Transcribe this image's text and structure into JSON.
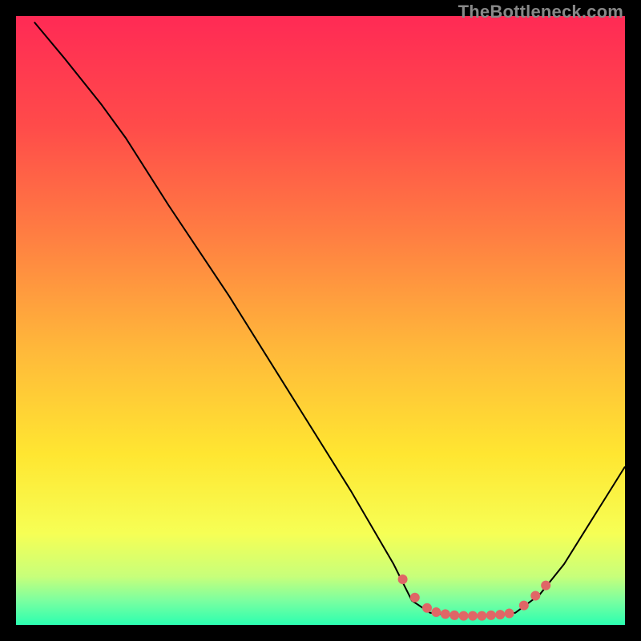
{
  "watermark": "TheBottleneck.com",
  "chart_data": {
    "type": "line",
    "title": "",
    "xlabel": "",
    "ylabel": "",
    "xlim": [
      0,
      100
    ],
    "ylim": [
      0,
      100
    ],
    "grid": false,
    "gradient_stops": [
      {
        "offset": 0,
        "color": "#ff2a55"
      },
      {
        "offset": 18,
        "color": "#ff4b4a"
      },
      {
        "offset": 36,
        "color": "#ff7e42"
      },
      {
        "offset": 55,
        "color": "#ffb93a"
      },
      {
        "offset": 72,
        "color": "#ffe631"
      },
      {
        "offset": 85,
        "color": "#f6ff55"
      },
      {
        "offset": 92,
        "color": "#c8ff7a"
      },
      {
        "offset": 96,
        "color": "#7bffa0"
      },
      {
        "offset": 100,
        "color": "#2bffb0"
      }
    ],
    "series": [
      {
        "name": "curve",
        "color": "#000000",
        "stroke_width": 2,
        "points": [
          {
            "x": 3,
            "y": 99
          },
          {
            "x": 8,
            "y": 93
          },
          {
            "x": 14,
            "y": 85.5
          },
          {
            "x": 18,
            "y": 80
          },
          {
            "x": 25,
            "y": 69
          },
          {
            "x": 35,
            "y": 54
          },
          {
            "x": 45,
            "y": 38
          },
          {
            "x": 55,
            "y": 22
          },
          {
            "x": 62,
            "y": 10
          },
          {
            "x": 65,
            "y": 4
          },
          {
            "x": 68,
            "y": 2
          },
          {
            "x": 72,
            "y": 1.5
          },
          {
            "x": 78,
            "y": 1.5
          },
          {
            "x": 82,
            "y": 2
          },
          {
            "x": 86,
            "y": 5
          },
          {
            "x": 90,
            "y": 10
          },
          {
            "x": 95,
            "y": 18
          },
          {
            "x": 100,
            "y": 26
          }
        ]
      },
      {
        "name": "highlight-dots",
        "color": "#e06666",
        "marker_radius": 6,
        "points": [
          {
            "x": 63.5,
            "y": 7.5
          },
          {
            "x": 65.5,
            "y": 4.5
          },
          {
            "x": 67.5,
            "y": 2.8
          },
          {
            "x": 69,
            "y": 2.1
          },
          {
            "x": 70.5,
            "y": 1.8
          },
          {
            "x": 72,
            "y": 1.6
          },
          {
            "x": 73.5,
            "y": 1.5
          },
          {
            "x": 75,
            "y": 1.5
          },
          {
            "x": 76.5,
            "y": 1.5
          },
          {
            "x": 78,
            "y": 1.6
          },
          {
            "x": 79.5,
            "y": 1.7
          },
          {
            "x": 81,
            "y": 1.9
          },
          {
            "x": 83.4,
            "y": 3.2
          },
          {
            "x": 85.3,
            "y": 4.8
          },
          {
            "x": 87,
            "y": 6.5
          }
        ]
      }
    ]
  }
}
